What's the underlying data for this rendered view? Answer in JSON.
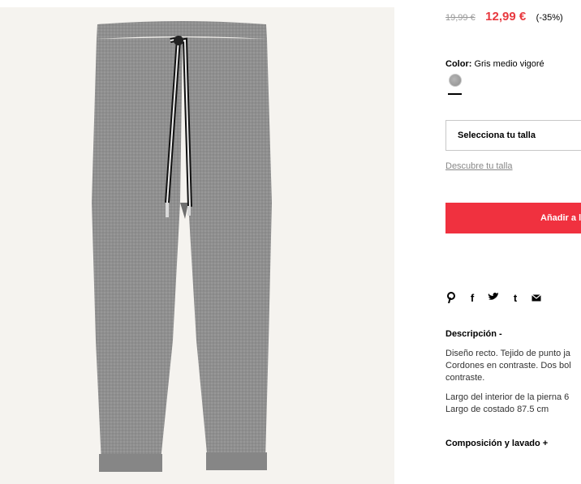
{
  "product": {
    "image_alt": "Pantalón jogger gris",
    "old_price": "19,99 €",
    "new_price": "12,99 €",
    "discount": "(-35%)",
    "color_label": "Color:",
    "color_value": "Gris medio vigoré",
    "swatch_color": "#9d9d9d"
  },
  "size": {
    "select_label": "Selecciona tu talla",
    "guide_link": "Descubre tu talla"
  },
  "cart": {
    "add_label": "Añadir a la cesta"
  },
  "share_icons": [
    "pinterest-icon",
    "facebook-icon",
    "twitter-icon",
    "tumblr-icon",
    "email-icon"
  ],
  "description": {
    "title": "Descripción -",
    "lines": [
      "Diseño recto. Tejido de punto ja",
      "Cordones en contraste. Dos bol",
      "contraste.",
      "Largo del interior de la pierna 6",
      "Largo de costado 87.5 cm"
    ]
  },
  "composition": {
    "title": "Composición y lavado +"
  },
  "colors": {
    "accent": "#f0313f",
    "price_red": "#e8393f"
  }
}
